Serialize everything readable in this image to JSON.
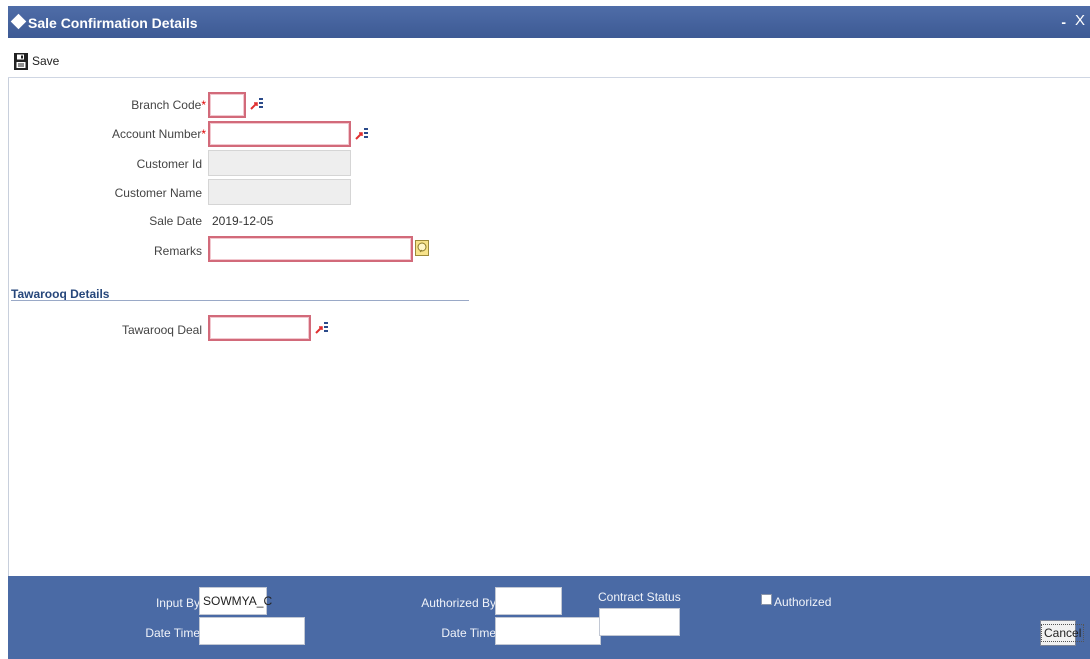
{
  "window": {
    "title": "Sale Confirmation Details",
    "minimize_label": "-",
    "close_label": "X"
  },
  "toolbar": {
    "save_label": "Save"
  },
  "form": {
    "branch_code": {
      "label": "Branch Code",
      "required": "*",
      "value": ""
    },
    "account_number": {
      "label": "Account Number",
      "required": "*",
      "value": ""
    },
    "customer_id": {
      "label": "Customer Id",
      "value": ""
    },
    "customer_name": {
      "label": "Customer Name",
      "value": ""
    },
    "sale_date": {
      "label": "Sale Date",
      "value": "2019-12-05"
    },
    "remarks": {
      "label": "Remarks",
      "value": ""
    }
  },
  "tawarooq": {
    "section_title": "Tawarooq Details",
    "deal": {
      "label": "Tawarooq Deal",
      "value": ""
    }
  },
  "footer": {
    "input_by": {
      "label": "Input By",
      "value": "SOWMYA_C"
    },
    "date_time_1": {
      "label": "Date Time",
      "value": ""
    },
    "authorized_by": {
      "label": "Authorized By",
      "value": ""
    },
    "date_time_2": {
      "label": "Date Time",
      "value": ""
    },
    "contract_status": {
      "label": "Contract Status",
      "value": ""
    },
    "authorized": {
      "label": "Authorized",
      "checked": false
    },
    "cancel_label": "Cancel"
  },
  "colors": {
    "titlebar": "#3d5a94",
    "footer": "#4a6aa5",
    "mandatory_border": "#d26a7a",
    "section_title": "#27477b"
  }
}
